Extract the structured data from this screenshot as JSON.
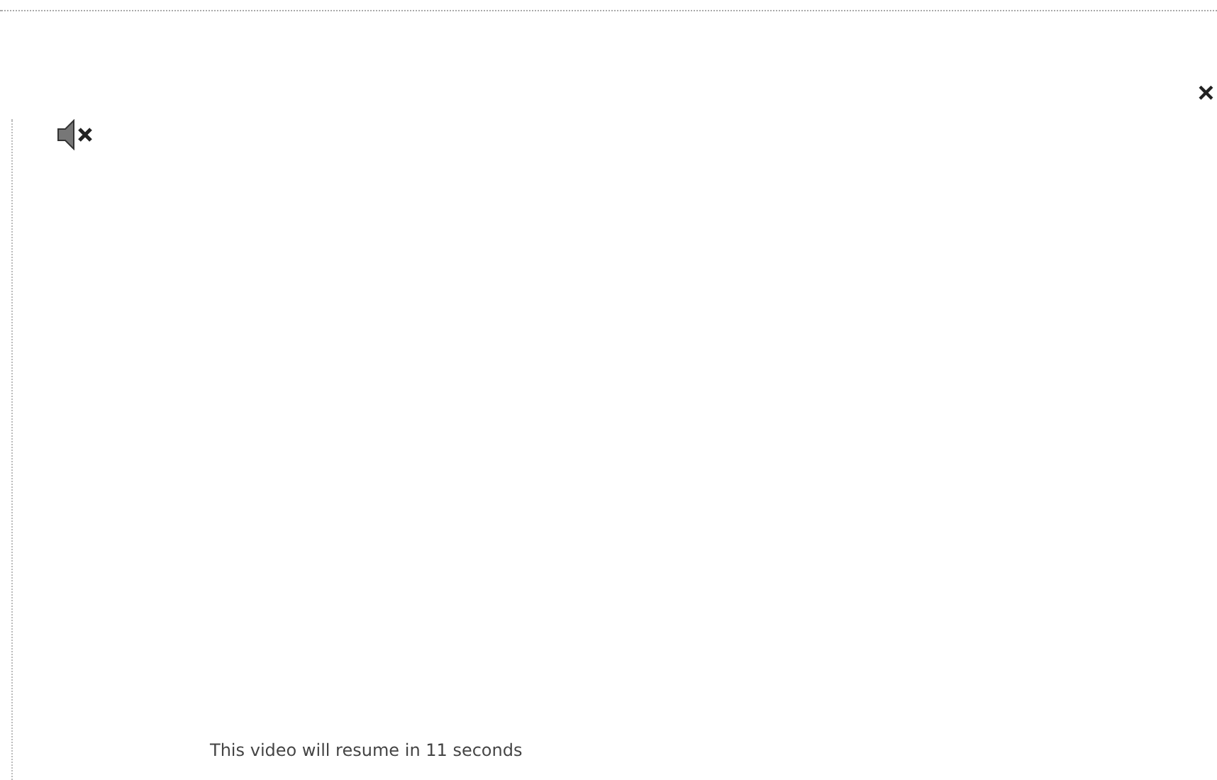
{
  "close_button": {
    "glyph": "×"
  },
  "audio": {
    "muted": true
  },
  "message": "This video will resume in 11 seconds"
}
